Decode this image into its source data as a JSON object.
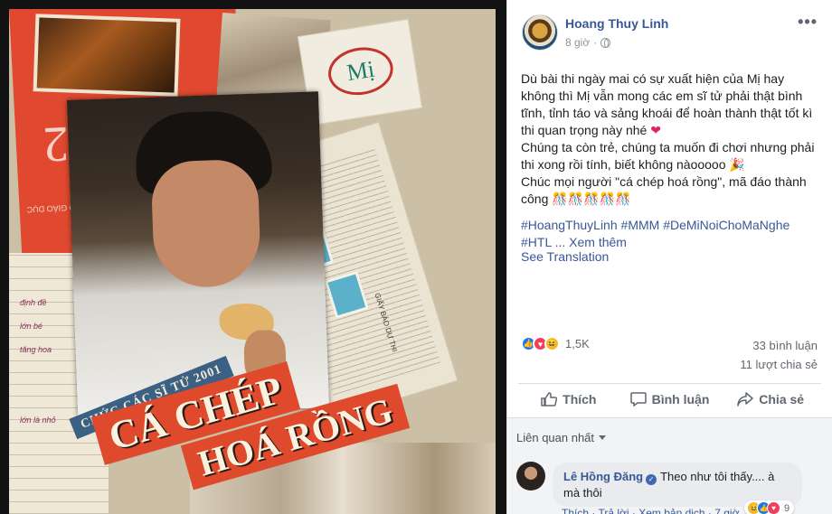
{
  "poster": {
    "banner_small": "CHỨC CÁC SĨ TỬ 2001",
    "banner_line1": "CÁ CHÉP",
    "banner_line2": "HOÁ RỒNG",
    "sticker_text": "Mị",
    "red_paper_text": "ĐÃI 12",
    "red_paper_small": "BỘ GIÁO DỤC",
    "newspaper_vertical": "GIẤY BÁO DỰ THI",
    "notebook_lines": [
      "định đề",
      "lớn bé",
      "tăng hoa",
      "lớn là nhỏ"
    ]
  },
  "post": {
    "author": "Hoang Thuy Linh",
    "time": "8 giờ",
    "more_label": "•••",
    "body": [
      "Dù bài thi ngày mai có sự xuất hiện của Mị hay không thì Mị vẫn mong các em sĩ tử phải thật bình tĩnh, tỉnh táo và sảng khoái để hoàn thành thật tốt kì thi quan trọng này nhé",
      "Chúng ta còn trẻ, chúng ta muốn đi chơi nhưng phải thi xong rồi tính, biết không nàooooo",
      "Chúc mọi người \"cá chép hoá rồng\", mã đáo thành công"
    ],
    "heart_glyph": "❤",
    "party_glyph": "🎉",
    "cake_glyphs": "🎊🎊🎊🎊🎊",
    "hashtags": [
      "#HoangThuyLinh",
      "#MMM",
      "#DeMiNoiChoMaNghe",
      "#HTL"
    ],
    "see_more": "... Xem thêm",
    "see_translation": "See Translation",
    "reaction_count": "1,5K",
    "comments_count": "33 bình luận",
    "shares_count": "11 lượt chia sẻ",
    "actions": {
      "like": "Thích",
      "comment": "Bình luận",
      "share": "Chia sẻ"
    }
  },
  "comments": {
    "sort_label": "Liên quan nhất",
    "items": [
      {
        "author": "Lê Hồng Đăng",
        "text": "Theo như tôi thấy.... à mà thôi",
        "reaction_count": "9",
        "links": "Thích · Trả lời · Xem bản dịch · 7 giờ"
      }
    ]
  },
  "colors": {
    "link": "#385898",
    "like_blue": "#1877f2",
    "love_red": "#f33e58",
    "haha_yellow": "#f7b928"
  }
}
